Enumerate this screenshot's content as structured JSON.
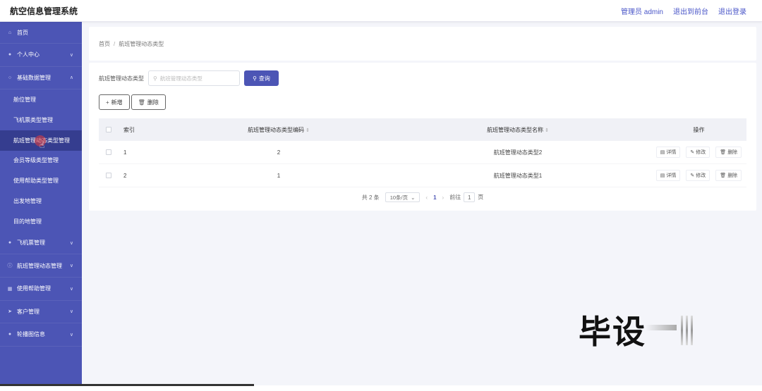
{
  "header": {
    "title": "航空信息管理系统",
    "admin": "管理员 admin",
    "back_to_front": "退出到前台",
    "logout": "退出登录"
  },
  "sidebar": {
    "items": [
      {
        "label": "首页",
        "icon": "home-icon",
        "expandable": false
      },
      {
        "label": "个人中心",
        "icon": "user-icon",
        "expandable": true
      },
      {
        "label": "基础数据管理",
        "icon": "database-icon",
        "expandable": true,
        "expanded": true
      }
    ],
    "sub_items": [
      "舱位管理",
      "飞机票类型管理",
      "航班管理动态类型管理",
      "会员等级类型管理",
      "使用帮助类型管理",
      "出发地管理",
      "目的地管理"
    ],
    "active_sub": "航班管理动态类型管理",
    "more_items": [
      {
        "label": "飞机票管理",
        "icon": "user-icon"
      },
      {
        "label": "航班管理动态管理",
        "icon": "info-icon"
      },
      {
        "label": "使用帮助管理",
        "icon": "grid-icon"
      },
      {
        "label": "客户管理",
        "icon": "send-icon"
      },
      {
        "label": "轮播图信息",
        "icon": "user-icon"
      }
    ]
  },
  "breadcrumb": {
    "home": "首页",
    "separator": "/",
    "current": "航班管理动态类型"
  },
  "search": {
    "label": "航班管理动态类型",
    "placeholder": "航班管理动态类型",
    "button": "查询"
  },
  "actions": {
    "add": "新增",
    "delete": "删除"
  },
  "table": {
    "headers": {
      "index": "索引",
      "code": "航班管理动态类型编码",
      "name": "航班管理动态类型名称",
      "ops": "操作"
    },
    "rows": [
      {
        "index": "1",
        "code": "2",
        "name": "航班管理动态类型2"
      },
      {
        "index": "2",
        "code": "1",
        "name": "航班管理动态类型1"
      }
    ],
    "ops": {
      "detail": "详情",
      "edit": "修改",
      "delete": "删除"
    }
  },
  "pagination": {
    "total": "共 2 条",
    "page_size": "10条/页",
    "current": "1",
    "goto_prefix": "前往",
    "goto_value": "1",
    "goto_suffix": "页"
  },
  "watermark": "毕设",
  "colors": {
    "primary": "#4c55b5",
    "sidebar_active": "#353d8f",
    "background": "#f4f5fa"
  }
}
